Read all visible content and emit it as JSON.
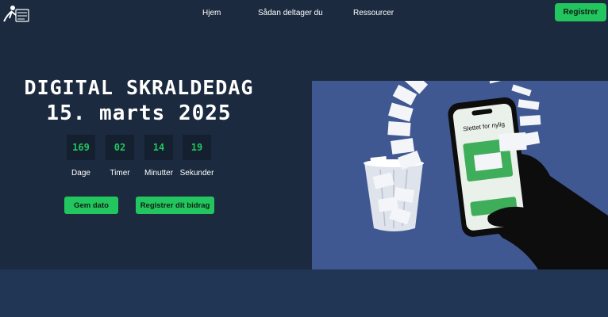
{
  "header": {
    "logo_icon": "digital-cleanup-logo",
    "nav": [
      "Hjem",
      "Sådan deltager du",
      "Ressourcer"
    ],
    "register_label": "Registrer"
  },
  "hero": {
    "title_line1": "DIGITAL SKRALDEDAG",
    "title_line2": "15. marts 2025",
    "countdown": [
      {
        "value": "169",
        "label": "Dage"
      },
      {
        "value": "02",
        "label": "Timer"
      },
      {
        "value": "14",
        "label": "Minutter"
      },
      {
        "value": "19",
        "label": "Sekunder"
      }
    ],
    "save_date_label": "Gem dato",
    "register_contribution_label": "Registrer dit bidrag"
  },
  "illustration": {
    "phone_text": "Slettet for nylig"
  },
  "colors": {
    "background": "#1b2a3f",
    "accent": "#22c55e",
    "illustration_bg": "#3f5891"
  }
}
